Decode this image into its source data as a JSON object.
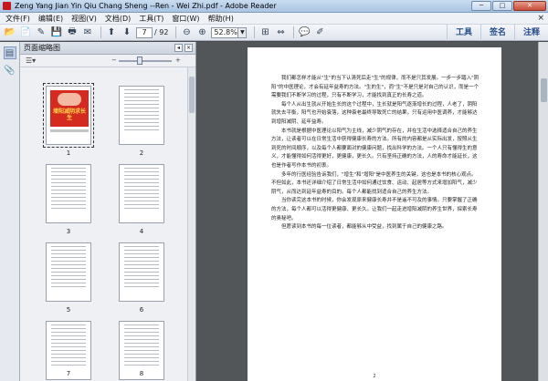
{
  "window": {
    "title": "Zeng Yang Jian Yin Qiu Chang Sheng --Ren - Wei Zhi.pdf - Adobe Reader",
    "minimize": "─",
    "maximize": "□",
    "close": "✕"
  },
  "menu": {
    "items": [
      "文件(F)",
      "编辑(E)",
      "视图(V)",
      "文档(D)",
      "工具(T)",
      "窗口(W)",
      "帮助(H)"
    ],
    "close_doc": "×"
  },
  "toolbar": {
    "current_page": "7",
    "total_pages": "/ 92",
    "zoom": "52.8%",
    "tools_label": "工具",
    "sign_label": "签名",
    "comment_label": "注释"
  },
  "panel": {
    "title": "页面缩略图",
    "options_label": "☰▾",
    "slider_minus": "−",
    "slider_plus": "+"
  },
  "thumbnails": [
    {
      "label": "1"
    },
    {
      "label": "2"
    },
    {
      "label": "3"
    },
    {
      "label": "4"
    },
    {
      "label": "5"
    },
    {
      "label": "6"
    },
    {
      "label": "7"
    },
    {
      "label": "8"
    }
  ],
  "cover": {
    "title": "增阳减阴求长生"
  },
  "document": {
    "paragraphs": [
      "我们都怎样才能从\"生\"的当下认清死后走\"生\"的规律，而不是只其发展。一步一步踏入\"阴阳\"的中医理论，才会有延年益寿的方法。\"生的生\"，而\"生\"不是只是对自己的认识，而是一个需要我们不断学习的过程，只有不断学习，才能找到真正的长寿之道。",
      "每个人从出生就从开始生长的这个过程中，生长就是阳气逐渐增长的过程，人老了，阴阳就失去平衡，阳气也开始衰落，这种衰老最终导致死亡的结果，只有运用中医调养，才能够达到增阳减阴、延年益寿。",
      "本书就是根据中医理论以阳气为主线，减少阴气的存在，并在生活中选择适合自己的养生方法，让读者可以在日常生活中获得健康长寿的方法。所有的内容都是从实际出发，按照从生到死的时间顺序，以及每个人都要面对的健康问题，找出科学的方法。一个人只有懂得生的意义，才能懂得如何活得更好，更健康，更长久。只有坚持正确的方法，人的寿命才能延长，这也是作者写作本书的初衷。",
      "多年的行医经验告诉我们，\"增生\"和\"增阳\"是中医养生的关键，这也是本书的核心观点。不但如此，本书还详细介绍了日常生活中如何通过饮食、运动、起居等方式来增加阳气，减少阴气，从而达到延年益寿的目的。每个人都能找到适合自己的养生方法。",
      "当你读完这本书的时候，你会发现原来健康长寿并不是遥不可及的事情。只要掌握了正确的方法，每个人都可以活得更健康、更长久。让我们一起走进增阳减阴的养生世界，探索长寿的奥秘吧。",
      "但愿读到本书的每一位读者，都能够从中受益，找到属于自己的健康之路。"
    ],
    "page_number": "2"
  }
}
